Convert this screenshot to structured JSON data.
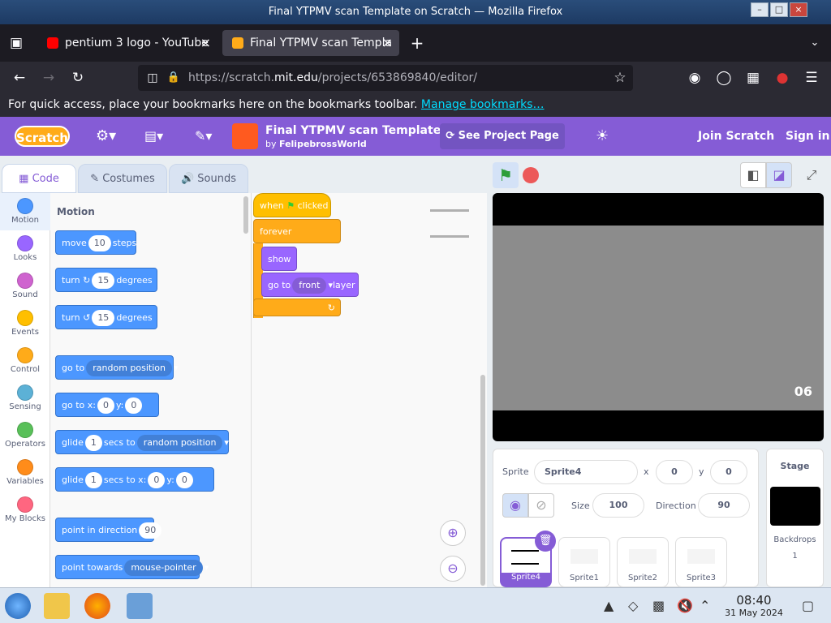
{
  "window": {
    "title": "Final YTPMV scan Template on Scratch — Mozilla Firefox"
  },
  "tabs": [
    {
      "label": "pentium 3 logo - YouTube",
      "close": "×"
    },
    {
      "label": "Final YTPMV scan Templa",
      "close": "×"
    }
  ],
  "new_tab": "+",
  "nav": {
    "url_prefix": "https://scratch.",
    "url_domain": "mit.edu",
    "url_path": "/projects/653869840/editor/"
  },
  "bookmarks_bar": {
    "text": "For quick access, place your bookmarks here on the bookmarks toolbar.",
    "link": "Manage bookmarks…"
  },
  "scratch_menu": {
    "logo": "Scratch",
    "project_title": "Final YTPMV scan Template",
    "by": "by",
    "author": "FelipebrossWorld",
    "see_project": "See Project Page",
    "join": "Join Scratch",
    "signin": "Sign in"
  },
  "editor_tabs": [
    "Code",
    "Costumes",
    "Sounds"
  ],
  "categories": [
    {
      "label": "Motion",
      "color": "#4c97ff"
    },
    {
      "label": "Looks",
      "color": "#9966ff"
    },
    {
      "label": "Sound",
      "color": "#cf63cf"
    },
    {
      "label": "Events",
      "color": "#ffbf00"
    },
    {
      "label": "Control",
      "color": "#ffab19"
    },
    {
      "label": "Sensing",
      "color": "#5cb1d6"
    },
    {
      "label": "Operators",
      "color": "#59c059"
    },
    {
      "label": "Variables",
      "color": "#ff8c1a"
    },
    {
      "label": "My Blocks",
      "color": "#ff6680"
    }
  ],
  "palette": {
    "heading": "Motion",
    "move": {
      "a": "move",
      "v": "10",
      "b": "steps"
    },
    "turn_right": {
      "a": "turn",
      "v": "15",
      "b": "degrees"
    },
    "turn_left": {
      "a": "turn",
      "v": "15",
      "b": "degrees"
    },
    "goto": {
      "a": "go to",
      "d": "random position"
    },
    "gotoxy": {
      "a": "go to x:",
      "x": "0",
      "y_label": "y:",
      "y": "0"
    },
    "glide": {
      "a": "glide",
      "v": "1",
      "b": "secs to",
      "d": "random position"
    },
    "glidexy": {
      "a": "glide",
      "v": "1",
      "b": "secs to x:",
      "x": "0",
      "y_label": "y:",
      "y": "0"
    },
    "point_dir": {
      "a": "point in direction",
      "v": "90"
    },
    "point_towards": {
      "a": "point towards",
      "d": "mouse-pointer"
    }
  },
  "script": {
    "hat_a": "when",
    "hat_b": "clicked",
    "forever": "forever",
    "show": "show",
    "goto_a": "go to",
    "goto_d": "front",
    "goto_b": "layer"
  },
  "stage": {
    "overlay_text": "06"
  },
  "sprite_info": {
    "sprite_label": "Sprite",
    "sprite_name": "Sprite4",
    "x_label": "x",
    "x": "0",
    "y_label": "y",
    "y": "0",
    "size_label": "Size",
    "size": "100",
    "direction_label": "Direction",
    "direction": "90"
  },
  "sprites": [
    "Sprite4",
    "Sprite1",
    "Sprite2",
    "Sprite3"
  ],
  "stage_panel": {
    "title": "Stage",
    "backdrops_label": "Backdrops",
    "backdrops_count": "1"
  },
  "taskbar": {
    "time": "08:40",
    "date": "31 May 2024"
  }
}
